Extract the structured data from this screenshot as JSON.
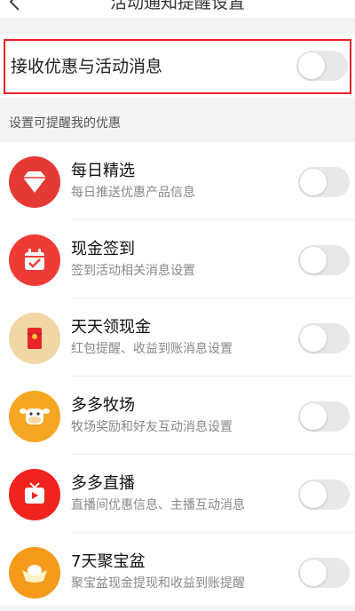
{
  "header": {
    "title": "活动通知提醒设置"
  },
  "highlight": {
    "label": "接收优惠与活动消息",
    "enabled": false
  },
  "section": {
    "title": "设置可提醒我的优惠"
  },
  "items": [
    {
      "title": "每日精选",
      "subtitle": "每日推送优惠产品信息",
      "icon": "diamond-icon",
      "color": "#e53935",
      "enabled": false
    },
    {
      "title": "现金签到",
      "subtitle": "签到活动相关消息设置",
      "icon": "calendar-check-icon",
      "color": "#ef3b36",
      "enabled": false
    },
    {
      "title": "天天领现金",
      "subtitle": "红包提醒、收益到账消息设置",
      "icon": "red-envelope-icon",
      "color": "#f1d7a6",
      "enabled": false
    },
    {
      "title": "多多牧场",
      "subtitle": "牧场奖励和好友互动消息设置",
      "icon": "cow-icon",
      "color": "#f5a623",
      "enabled": false
    },
    {
      "title": "多多直播",
      "subtitle": "直播间优惠信息、主播互动消息",
      "icon": "tv-icon",
      "color": "#f0231e",
      "enabled": false
    },
    {
      "title": "7天聚宝盆",
      "subtitle": "聚宝盆现金提现和收益到账提醒",
      "icon": "gold-ingot-icon",
      "color": "#f59a1b",
      "enabled": false
    }
  ]
}
